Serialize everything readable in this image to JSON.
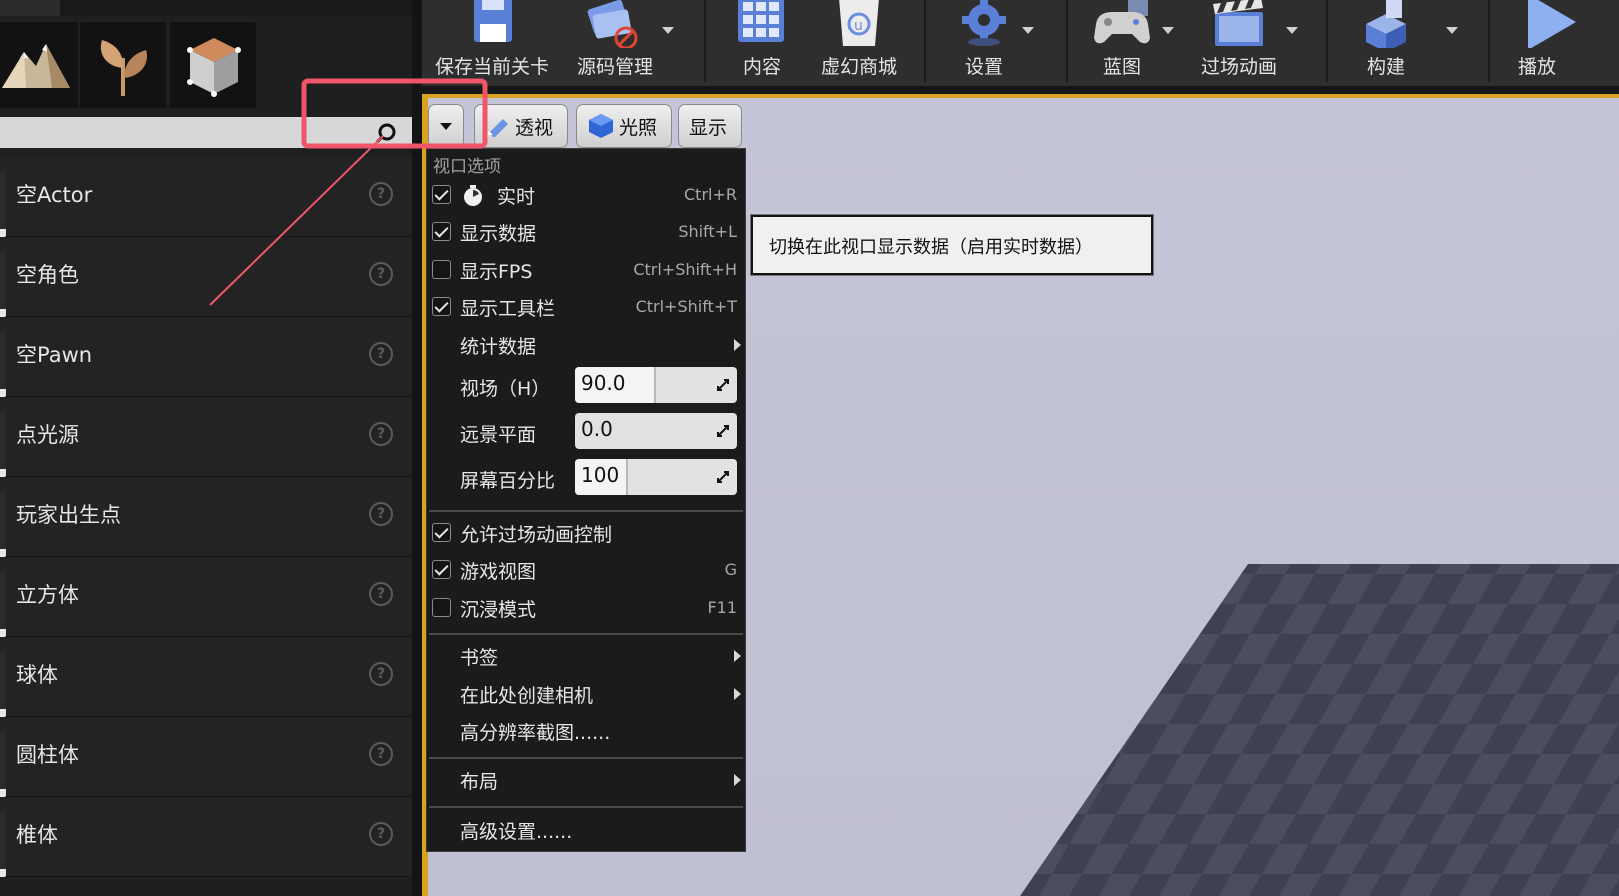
{
  "left_panel": {
    "search": {
      "value": "",
      "placeholder": ""
    },
    "mode_tiles": [
      "landscape-mode-icon",
      "foliage-mode-icon",
      "geometry-mode-icon"
    ],
    "class_items": [
      {
        "label": "空Actor"
      },
      {
        "label": "空角色"
      },
      {
        "label": "空Pawn"
      },
      {
        "label": "点光源"
      },
      {
        "label": "玩家出生点"
      },
      {
        "label": "立方体"
      },
      {
        "label": "球体"
      },
      {
        "label": "圆柱体"
      },
      {
        "label": "椎体"
      }
    ],
    "help_glyph": "?"
  },
  "toolbar": {
    "save": "保存当前关卡",
    "source_control": "源码管理",
    "content": "内容",
    "marketplace": "虚幻商城",
    "settings": "设置",
    "blueprints": "蓝图",
    "cinematics": "过场动画",
    "build": "构建",
    "play": "播放"
  },
  "viewport_toolbar": {
    "perspective": "透视",
    "lighting": "光照",
    "show": "显示"
  },
  "options_menu": {
    "heading": "视口选项",
    "realtime": {
      "label": "实时",
      "shortcut": "Ctrl+R",
      "checked": true
    },
    "show_stats": {
      "label": "显示数据",
      "shortcut": "Shift+L",
      "checked": true
    },
    "show_fps": {
      "label": "显示FPS",
      "shortcut": "Ctrl+Shift+H",
      "checked": false
    },
    "show_toolbar": {
      "label": "显示工具栏",
      "shortcut": "Ctrl+Shift+T",
      "checked": true
    },
    "stats": {
      "label": "统计数据"
    },
    "fov": {
      "label": "视场（H）",
      "value": "90.0",
      "fill_fraction": 0.5
    },
    "far_plane": {
      "label": "远景平面",
      "value": "0.0",
      "fill_fraction": 0.0
    },
    "screen_percentage": {
      "label": "屏幕百分比",
      "value": "100",
      "fill_fraction": 0.33
    },
    "allow_cinematic_control": {
      "label": "允许过场动画控制",
      "checked": true
    },
    "game_view": {
      "label": "游戏视图",
      "shortcut": "G",
      "checked": true
    },
    "immersive_mode": {
      "label": "沉浸模式",
      "shortcut": "F11",
      "checked": false
    },
    "bookmarks": {
      "label": "书签"
    },
    "create_camera": {
      "label": "在此处创建相机"
    },
    "high_res_screenshot": {
      "label": "高分辨率截图......"
    },
    "layouts": {
      "label": "布局"
    },
    "advanced_settings": {
      "label": "高级设置......"
    }
  },
  "tooltip": {
    "text": "切换在此视口显示数据（启用实时数据）"
  },
  "colors": {
    "viewport_frame": "#d9a21f",
    "annotation": "#f0566a",
    "viewport_sky": "#c4c5d6"
  }
}
